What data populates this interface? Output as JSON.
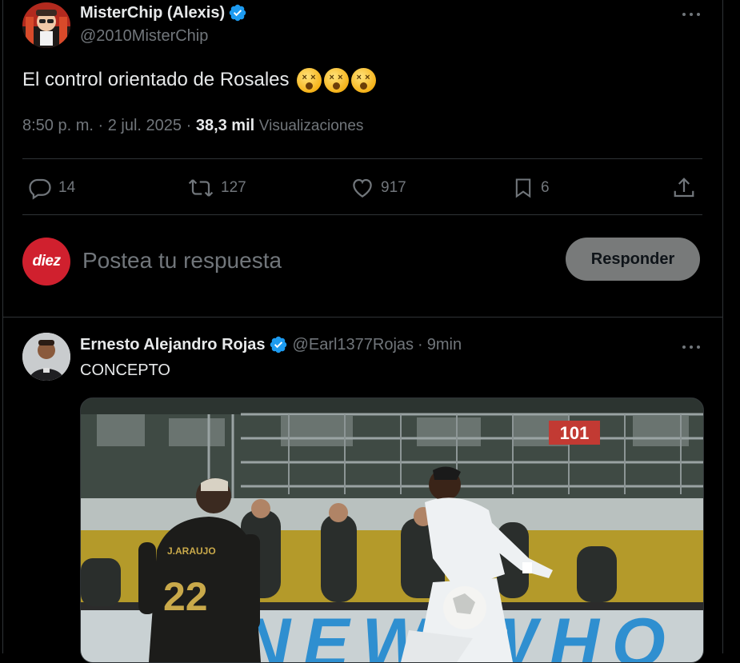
{
  "main_tweet": {
    "display_name": "MisterChip (Alexis)",
    "handle": "@2010MisterChip",
    "text": "El control orientado de Rosales",
    "emoji_count_icons": [
      "dizzy-face-emoji",
      "dizzy-face-emoji",
      "dizzy-face-emoji"
    ],
    "time": "8:50 p. m.",
    "separator": "·",
    "date": "2 jul. 2025",
    "views_count": "38,3 mil",
    "views_label": "Visualizaciones",
    "actions": {
      "replies": "14",
      "reposts": "127",
      "likes": "917",
      "bookmarks": "6"
    }
  },
  "reply_box": {
    "avatar_text": "diez",
    "placeholder": "Postea tu respuesta",
    "button_label": "Responder"
  },
  "reply_tweet": {
    "display_name": "Ernesto Alejandro Rojas",
    "handle": "@Earl1377Rojas",
    "separator": "·",
    "time_ago": "9min",
    "text": "CONCEPTO",
    "media": {
      "board_text": "101",
      "jersey_name": "J.ARAUJO",
      "jersey_number": "22",
      "ad_text": "NEW WHO"
    }
  },
  "colors": {
    "background": "#000000",
    "text_primary": "#e7e9ea",
    "text_muted": "#71767b",
    "divider": "#2f3336",
    "verified": "#1d9bf0",
    "diez_red": "#d0202e",
    "reply_button_bg": "#787a7a"
  }
}
